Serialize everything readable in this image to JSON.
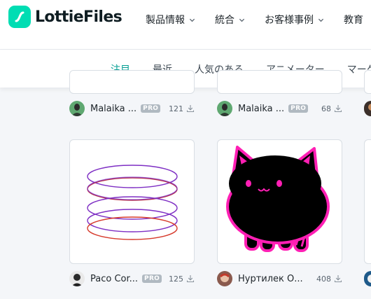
{
  "brand": {
    "name": "LottieFiles",
    "color": "#00ddb3"
  },
  "nav": {
    "items": [
      {
        "label": "製品情報",
        "icon": "chevron-down-icon"
      },
      {
        "label": "統合",
        "icon": "chevron-down-icon"
      },
      {
        "label": "お客様事例",
        "icon": "chevron-down-icon"
      },
      {
        "label": "教育"
      }
    ]
  },
  "subnav": {
    "tabs": [
      {
        "label": "注目",
        "active": true
      },
      {
        "label": "最近"
      },
      {
        "label": "人気のある"
      },
      {
        "label": "アニメーター"
      },
      {
        "label": "マーケ"
      }
    ],
    "active_color": "#019d91"
  },
  "cards": [
    {
      "author": "Malaika ...",
      "badge": "PRO",
      "downloads": "121",
      "avatar": "avatar-malaika"
    },
    {
      "author": "Malaika ...",
      "badge": "PRO",
      "downloads": "68",
      "avatar": "avatar-malaika"
    },
    {
      "author": "Paco Cor...",
      "badge": "PRO",
      "downloads": "125",
      "avatar": "avatar-paco",
      "preview": "stacked-rings-animation"
    },
    {
      "author": "Нуртилек О...",
      "downloads": "408",
      "avatar": "avatar-nurtilek",
      "preview": "black-cat-animation"
    }
  ]
}
